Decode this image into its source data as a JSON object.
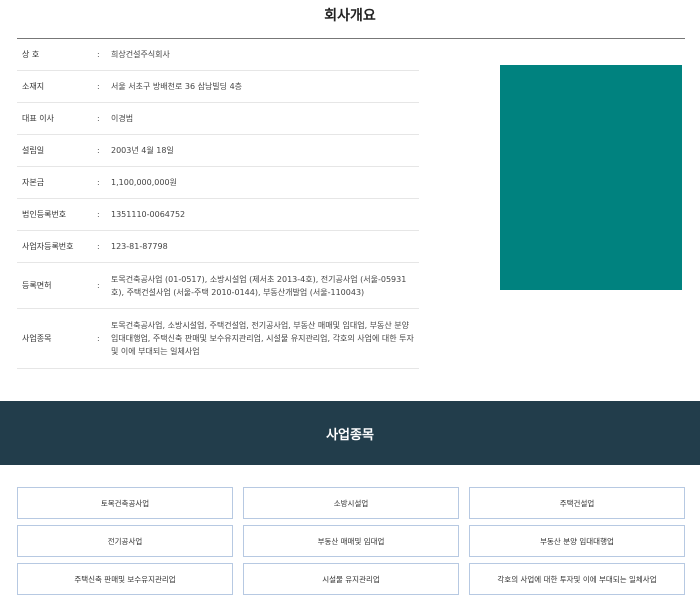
{
  "page": {
    "title": "회사개요"
  },
  "company_info": [
    {
      "label": "상 호",
      "value": "희상건설주식회사"
    },
    {
      "label": "소재지",
      "value": "서울 서초구 방배천로 36 삼남빌딩 4층"
    },
    {
      "label": "대표 이사",
      "value": "이경범"
    },
    {
      "label": "설립일",
      "value": "2003년 4월 18일"
    },
    {
      "label": "자본금",
      "value": "1,100,000,000원"
    },
    {
      "label": "법인등록번호",
      "value": "1351110-0064752"
    },
    {
      "label": "사업자등록번호",
      "value": "123-81-87798"
    },
    {
      "label": "등록면허",
      "value": "토목건축공사업 (01-0517), 소방시설업 (제서초 2013-4호), 전기공사업 (서울-05931호), 주택건설사업 (서울-주택 2010-0144), 부동산개발업 (서울-110043)"
    },
    {
      "label": "사업종목",
      "value": "토목건축공사업, 소방시설업, 주택건설업, 전기공사업, 부동산 매매및 임대업, 부동산 분양 임대대행업, 주택신축 판매및 보수유지관리업, 시설물 유지관리업, 각호의 사업에 대한 투자및 이에 부대되는 일체사업"
    }
  ],
  "info_separator": ":",
  "company_image_color": "#00827f",
  "business_section": {
    "title": "사업종목",
    "band_color": "#223d4b",
    "items": [
      "토목건축공사업",
      "소방시설업",
      "주택건설업",
      "전기공사업",
      "부동산 매매및 임대업",
      "부동산 분양 임대대행업",
      "주택신축 판매및 보수유지관리업",
      "시설물 유지관리업",
      "각호의 사업에 대한 투자및 이에 부대되는 일체사업"
    ]
  }
}
